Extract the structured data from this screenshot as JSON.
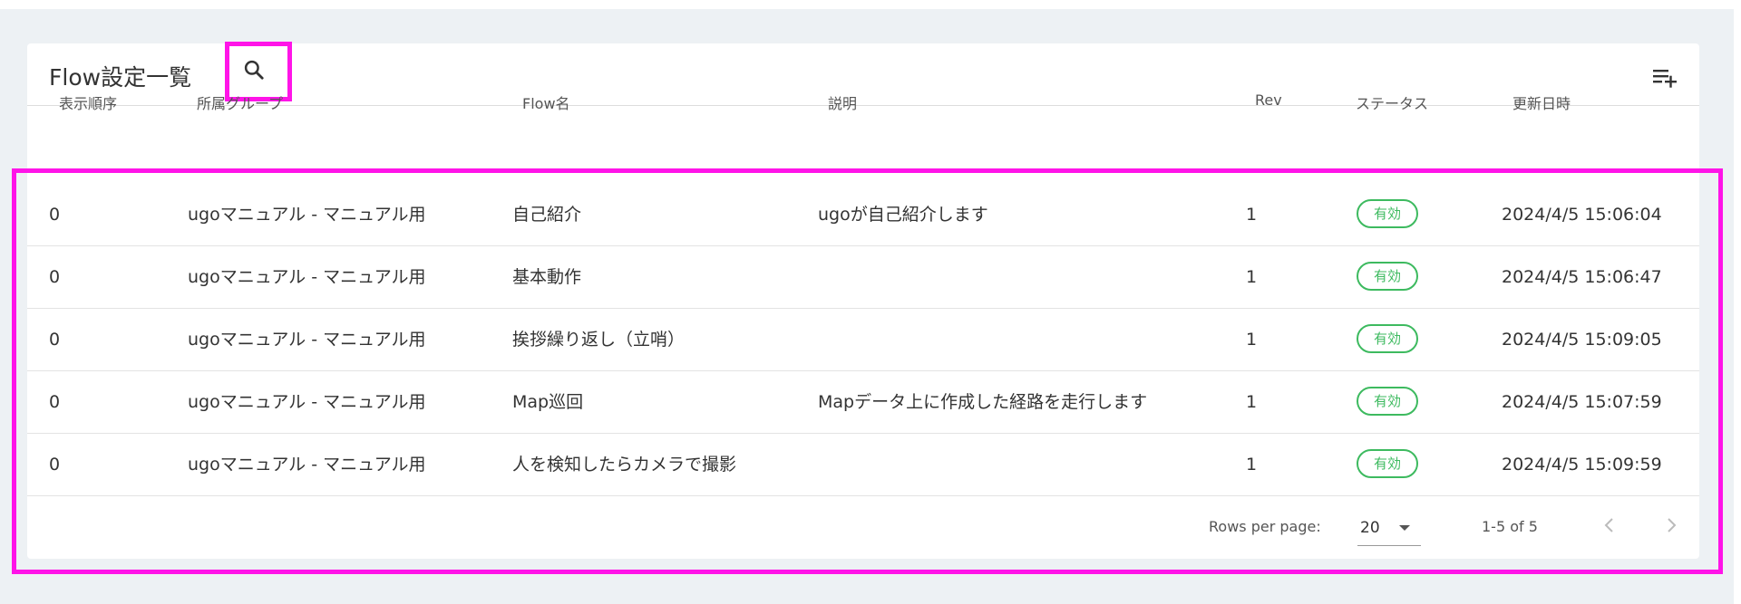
{
  "header": {
    "title": "Flow設定一覧",
    "search_icon": "search-icon",
    "add_icon": "playlist-add-icon"
  },
  "table": {
    "columns": {
      "order": "表示順序",
      "group": "所属グループ",
      "flow_name": "Flow名",
      "description": "説明",
      "rev": "Rev",
      "status": "ステータス",
      "updated": "更新日時"
    },
    "rows": [
      {
        "order": "0",
        "group": "ugoマニュアル - マニュアル用",
        "flow_name": "自己紹介",
        "description": "ugoが自己紹介します",
        "rev": "1",
        "status": "有効",
        "updated": "2024/4/5 15:06:04"
      },
      {
        "order": "0",
        "group": "ugoマニュアル - マニュアル用",
        "flow_name": "基本動作",
        "description": "",
        "rev": "1",
        "status": "有効",
        "updated": "2024/4/5 15:06:47"
      },
      {
        "order": "0",
        "group": "ugoマニュアル - マニュアル用",
        "flow_name": "挨拶繰り返し（立哨）",
        "description": "",
        "rev": "1",
        "status": "有効",
        "updated": "2024/4/5 15:09:05"
      },
      {
        "order": "0",
        "group": "ugoマニュアル - マニュアル用",
        "flow_name": "Map巡回",
        "description": "Mapデータ上に作成した経路を走行します",
        "rev": "1",
        "status": "有効",
        "updated": "2024/4/5 15:07:59"
      },
      {
        "order": "0",
        "group": "ugoマニュアル - マニュアル用",
        "flow_name": "人を検知したらカメラで撮影",
        "description": "",
        "rev": "1",
        "status": "有効",
        "updated": "2024/4/5 15:09:59"
      }
    ]
  },
  "pagination": {
    "rows_per_page_label": "Rows per page:",
    "rows_per_page_value": "20",
    "range_label": "1-5 of 5",
    "prev_icon": "chevron-left-icon",
    "next_icon": "chevron-right-icon"
  },
  "colors": {
    "highlight": "#ff14e8",
    "status_active": "#3dba5f",
    "page_background": "#edf1f4"
  }
}
